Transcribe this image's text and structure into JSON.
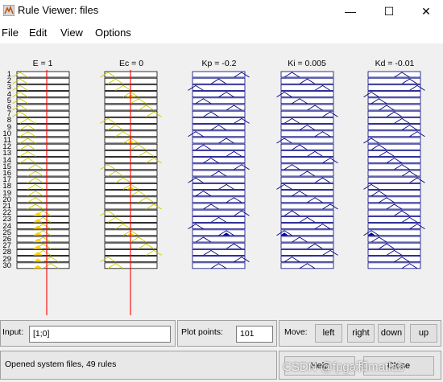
{
  "window": {
    "title": "Rule Viewer: files",
    "minimize_glyph": "—",
    "maximize_glyph": "☐",
    "close_glyph": "✕",
    "icon": "matlab-icon"
  },
  "menu": {
    "file": "File",
    "edit": "Edit",
    "view": "View",
    "options": "Options"
  },
  "columns": [
    {
      "label": "E = 1",
      "kind": "input"
    },
    {
      "label": "Ec = 0",
      "kind": "input"
    },
    {
      "label": "Kp = -0.2",
      "kind": "output"
    },
    {
      "label": "Ki = 0.005",
      "kind": "output"
    },
    {
      "label": "Kd = -0.01",
      "kind": "output"
    }
  ],
  "rules": {
    "visible_numbers": [
      "1",
      "2",
      "3",
      "4",
      "5",
      "6",
      "7",
      "8",
      "9",
      "10",
      "11",
      "12",
      "13",
      "14",
      "15",
      "16",
      "17",
      "18",
      "19",
      "20",
      "21",
      "22",
      "23",
      "24",
      "25",
      "26",
      "27",
      "28",
      "29",
      "30"
    ],
    "total": 49
  },
  "colors": {
    "input_mf": "#c8c800",
    "input_fill": "#ffd400",
    "output_mf": "#000080",
    "output_fill": "#0000a0",
    "indicator_line": "#ff0000"
  },
  "controls": {
    "input_label": "Input:",
    "input_value": "[1;0]",
    "plot_points_label": "Plot points:",
    "plot_points_value": "101",
    "move_label": "Move:",
    "move_left": "left",
    "move_right": "right",
    "move_down": "down",
    "move_up": "up"
  },
  "status": {
    "message": "Opened system files, 49 rules",
    "help": "Help",
    "close": "Close",
    "watermark": "CSDN @fpga和matlab"
  }
}
